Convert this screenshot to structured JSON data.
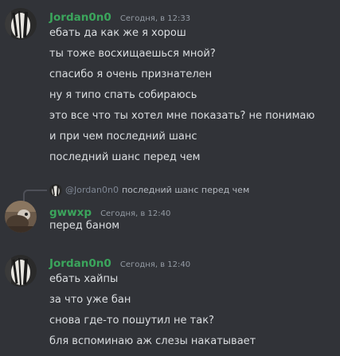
{
  "colors": {
    "background": "#313338",
    "username": "#3ba55c",
    "timestamp": "#949ba4",
    "message_text": "#dbdee1",
    "reply_text": "#b5bac1"
  },
  "groups": [
    {
      "author": "Jordan0n0",
      "timestamp": "Сегодня, в 12:33",
      "avatar_icon": "user-avatar-icon",
      "messages": [
        "ебать да как же я хорош",
        "ты тоже восхищаешься мной?",
        "спасибо я очень признателен",
        "ну я типо спать собираюсь",
        "это все что ты хотел мне показать? не понимаю",
        "и при чем последний шанс",
        "последний шанс перед чем"
      ]
    },
    {
      "author": "gwwxp",
      "timestamp": "Сегодня, в 12:40",
      "avatar_icon": "user-avatar-icon",
      "reply": {
        "mention": "@Jordan0n0",
        "text": "последний шанс перед чем"
      },
      "messages": [
        "перед баном"
      ]
    },
    {
      "author": "Jordan0n0",
      "timestamp": "Сегодня, в 12:40",
      "avatar_icon": "user-avatar-icon",
      "messages": [
        "ебать хайпы",
        "за что уже бан",
        "снова где-то пошутил не так?",
        "бля вспоминаю аж слезы накатывает"
      ]
    }
  ]
}
